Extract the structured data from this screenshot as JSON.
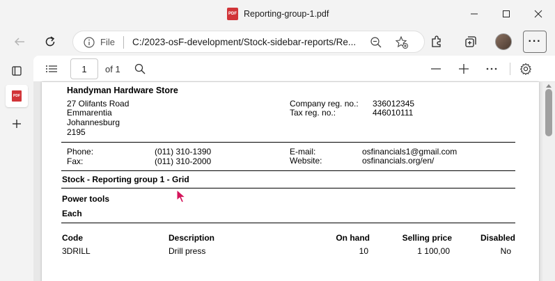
{
  "window": {
    "title": "Reporting-group-1.pdf",
    "pdf_badge": "PDF"
  },
  "address": {
    "info_label": "File",
    "url": "C:/2023-osF-development/Stock-sidebar-reports/Re..."
  },
  "pdf_toolbar": {
    "page_number": "1",
    "page_total": "of 1"
  },
  "report": {
    "company_name": "Handyman Hardware Store",
    "address_lines": [
      "27 Olifants Road",
      "Emmarentia",
      "Johannesburg",
      "2195"
    ],
    "company_reg_label": "Company reg. no.:",
    "company_reg_value": "336012345",
    "tax_reg_label": "Tax reg. no.:",
    "tax_reg_value": "446010111",
    "phone_label": "Phone:",
    "phone_value": "(011) 310-1390",
    "fax_label": "Fax:",
    "fax_value": "(011) 310-2000",
    "email_label": "E-mail:",
    "email_value": "osfinancials1@gmail.com",
    "website_label": "Website:",
    "website_value": "osfinancials.org/en/",
    "report_title": "Stock - Reporting group 1 - Grid",
    "group_1": "Power tools",
    "group_2": "Each",
    "columns": {
      "code": "Code",
      "description": "Description",
      "on_hand": "On hand",
      "selling_price": "Selling price",
      "disabled": "Disabled"
    },
    "rows": [
      {
        "code": "3DRILL",
        "description": "Drill press",
        "on_hand": "10",
        "selling_price": "1 100,00",
        "disabled": "No"
      }
    ]
  },
  "colors": {
    "pdf_red": "#d13438",
    "chrome_bg": "#f3f3f3",
    "cursor_red": "#d4145a"
  }
}
